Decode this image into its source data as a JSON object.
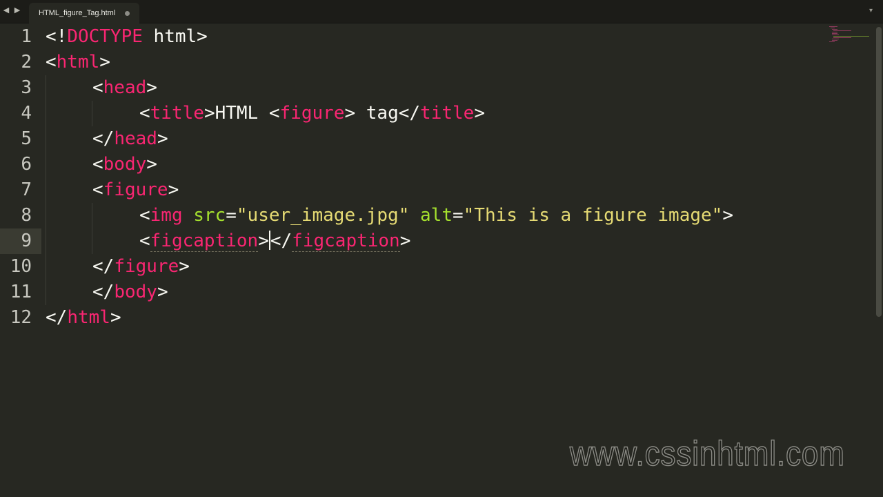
{
  "tabbar": {
    "nav_back": "◀",
    "nav_forward": "▶",
    "active_tab": {
      "label": "HTML_figure_Tag.html",
      "dirty": true
    },
    "overflow_icon": "chevron-down-icon"
  },
  "editor": {
    "line_numbers": [
      "1",
      "2",
      "3",
      "4",
      "5",
      "6",
      "7",
      "8",
      "9",
      "10",
      "11",
      "12"
    ],
    "current_line": 9,
    "tokens": {
      "l1_open": "<!",
      "l1_doctype": "DOCTYPE",
      "l1_rest": " html>",
      "l2_open": "<",
      "l2_tag": "html",
      "l2_close": ">",
      "l3_open": "<",
      "l3_tag": "head",
      "l3_close": ">",
      "l4_open": "<",
      "l4_tag": "title",
      "l4_gt": ">",
      "l4_text1": "HTML ",
      "l4_lt2": "<",
      "l4_fig": "figure",
      "l4_gt2": ">",
      "l4_text2": " tag",
      "l4_end_open": "</",
      "l4_end_tag": "title",
      "l4_end_close": ">",
      "l5_open": "</",
      "l5_tag": "head",
      "l5_close": ">",
      "l6_open": "<",
      "l6_tag": "body",
      "l6_close": ">",
      "l7_open": "<",
      "l7_tag": "figure",
      "l7_close": ">",
      "l8_open": "<",
      "l8_tag": "img",
      "l8_sp1": " ",
      "l8_attr1": "src",
      "l8_eq1": "=",
      "l8_val1": "\"user_image.jpg\"",
      "l8_sp2": " ",
      "l8_attr2": "alt",
      "l8_eq2": "=",
      "l8_val2": "\"This is a figure image\"",
      "l8_close": ">",
      "l9_open": "<",
      "l9_tag": "figcaption",
      "l9_close": ">",
      "l9_end_open": "</",
      "l9_end_tag": "figcaption",
      "l9_end_close": ">",
      "l10_open": "</",
      "l10_tag": "figure",
      "l10_close": ">",
      "l11_open": "</",
      "l11_tag": "body",
      "l11_close": ">",
      "l12_open": "</",
      "l12_tag": "html",
      "l12_close": ">"
    }
  },
  "watermark": {
    "text": "www.cssinhtml.com"
  },
  "colors": {
    "background": "#272822",
    "tag": "#f92672",
    "attribute": "#a6e22e",
    "string": "#e6db74",
    "text": "#f8f8f2"
  }
}
